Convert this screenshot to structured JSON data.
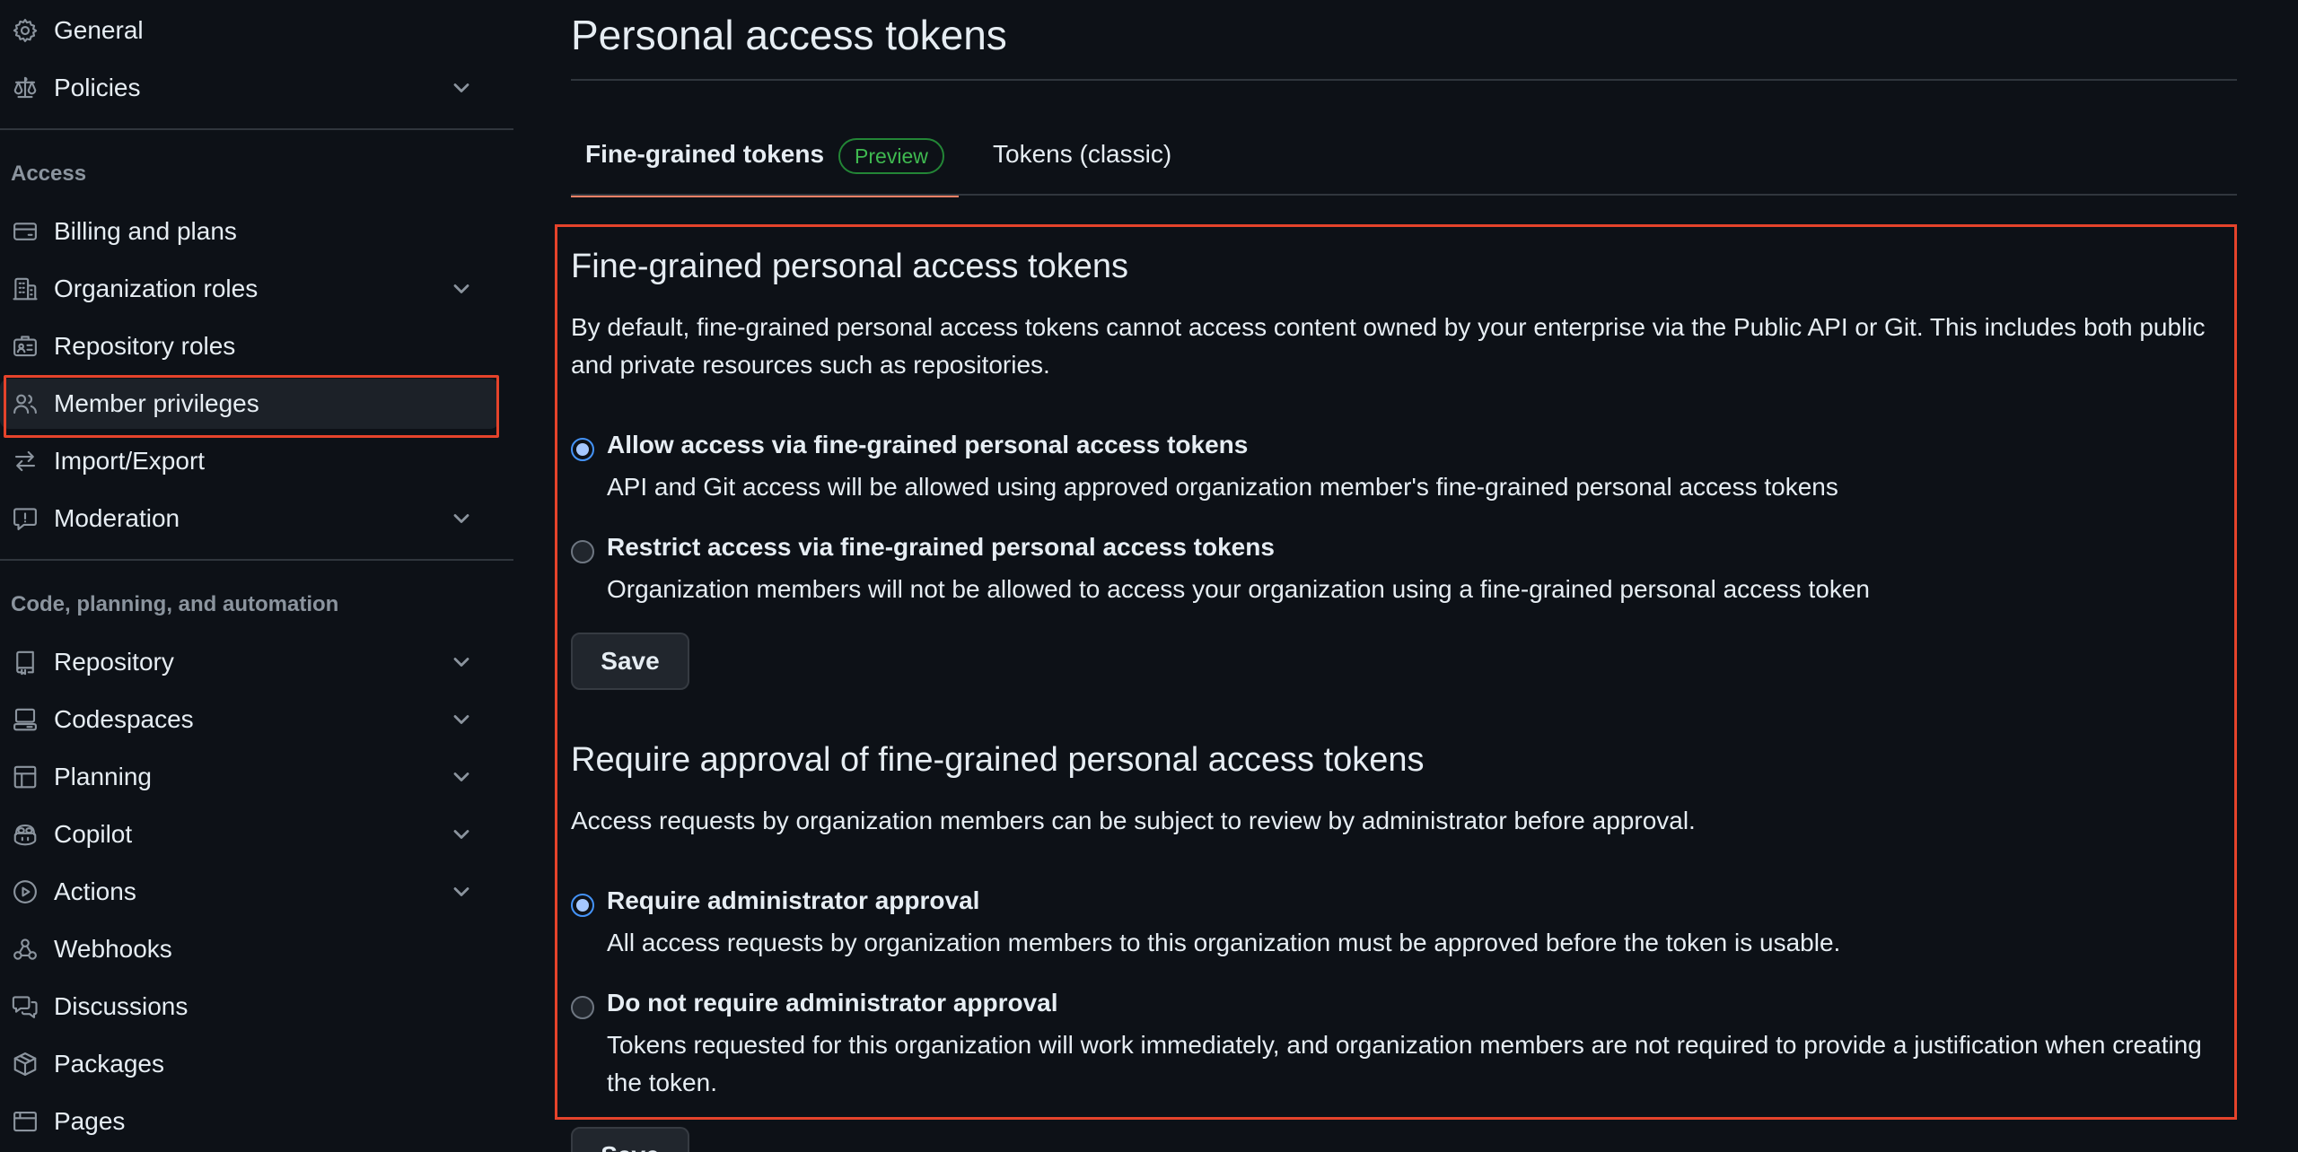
{
  "sidebar": {
    "top_items": [
      {
        "label": "General",
        "icon": "gear-icon"
      },
      {
        "label": "Policies",
        "icon": "law-icon"
      }
    ],
    "access_heading": "Access",
    "access_items": [
      {
        "label": "Billing and plans",
        "icon": "credit-card-icon"
      },
      {
        "label": "Organization roles",
        "icon": "organization-icon"
      },
      {
        "label": "Repository roles",
        "icon": "id-badge-icon"
      },
      {
        "label": "Member privileges",
        "icon": "people-icon"
      },
      {
        "label": "Import/Export",
        "icon": "arrow-switch-icon"
      },
      {
        "label": "Moderation",
        "icon": "report-icon"
      }
    ],
    "code_heading": "Code, planning, and automation",
    "code_items": [
      {
        "label": "Repository",
        "icon": "repo-icon"
      },
      {
        "label": "Codespaces",
        "icon": "codespaces-icon"
      },
      {
        "label": "Planning",
        "icon": "table-icon"
      },
      {
        "label": "Copilot",
        "icon": "copilot-icon"
      },
      {
        "label": "Actions",
        "icon": "play-icon"
      },
      {
        "label": "Webhooks",
        "icon": "webhook-icon"
      },
      {
        "label": "Discussions",
        "icon": "comment-discussion-icon"
      },
      {
        "label": "Packages",
        "icon": "package-icon"
      },
      {
        "label": "Pages",
        "icon": "browser-icon"
      }
    ]
  },
  "main": {
    "title": "Personal access tokens",
    "tabs": [
      {
        "label": "Fine-grained tokens",
        "badge": "Preview",
        "active": true
      },
      {
        "label": "Tokens (classic)",
        "active": false
      }
    ],
    "section1": {
      "heading": "Fine-grained personal access tokens",
      "description": "By default, fine-grained personal access tokens cannot access content owned by your enterprise via the Public API or Git. This includes both public and private resources such as repositories.",
      "options": [
        {
          "label": "Allow access via fine-grained personal access tokens",
          "note": "API and Git access will be allowed using approved organization member's fine-grained personal access tokens",
          "checked": true
        },
        {
          "label": "Restrict access via fine-grained personal access tokens",
          "note": "Organization members will not be allowed to access your organization using a fine-grained personal access token",
          "checked": false
        }
      ],
      "save_label": "Save"
    },
    "section2": {
      "heading": "Require approval of fine-grained personal access tokens",
      "description": "Access requests by organization members can be subject to review by administrator before approval.",
      "options": [
        {
          "label": "Require administrator approval",
          "note": "All access requests by organization members to this organization must be approved before the token is usable.",
          "checked": true
        },
        {
          "label": "Do not require administrator approval",
          "note": "Tokens requested for this organization will work immediately, and organization members are not required to provide a justification when creating the token.",
          "checked": false
        }
      ],
      "save_label": "Save"
    }
  },
  "colors": {
    "background": "#0d1117",
    "text": "#e6edf3",
    "muted": "#8b949e",
    "highlight_border": "#e5432b",
    "tab_underline": "#f78166",
    "badge_green": "#3fb950",
    "radio_blue": "#4493f8"
  }
}
